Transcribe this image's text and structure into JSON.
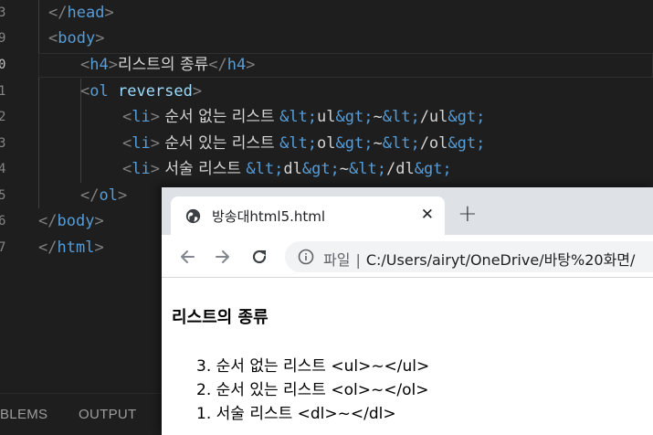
{
  "editor": {
    "line_numbers": [
      "3",
      "9",
      "0",
      "1",
      "2",
      "3",
      "4",
      "5",
      "6",
      "7"
    ],
    "lines": [
      {
        "id": "head-close",
        "tokens": [
          {
            "c": "tb",
            "t": "</"
          },
          {
            "c": "tn",
            "t": "head"
          },
          {
            "c": "tb",
            "t": ">"
          }
        ]
      },
      {
        "id": "body-open",
        "tokens": [
          {
            "c": "tb",
            "t": "<"
          },
          {
            "c": "tn",
            "t": "body"
          },
          {
            "c": "tb",
            "t": ">"
          }
        ]
      },
      {
        "id": "h4",
        "tokens": [
          {
            "c": "tb",
            "t": "<"
          },
          {
            "c": "tn",
            "t": "h4"
          },
          {
            "c": "tb",
            "t": ">"
          },
          {
            "c": "tx",
            "t": "리스트의 종류"
          },
          {
            "c": "tb",
            "t": "</"
          },
          {
            "c": "tn",
            "t": "h4"
          },
          {
            "c": "tb",
            "t": ">"
          }
        ]
      },
      {
        "id": "ol-open",
        "tokens": [
          {
            "c": "tb",
            "t": "<"
          },
          {
            "c": "tn",
            "t": "ol"
          },
          {
            "c": "et",
            "t": " "
          },
          {
            "c": "at",
            "t": "reversed"
          },
          {
            "c": "tb",
            "t": ">"
          }
        ]
      },
      {
        "id": "li-1",
        "tokens": [
          {
            "c": "tb",
            "t": "<"
          },
          {
            "c": "tn",
            "t": "li"
          },
          {
            "c": "tb",
            "t": ">"
          },
          {
            "c": "tx",
            "t": " 순서 없는 리스트 "
          },
          {
            "c": "en",
            "t": "&lt;"
          },
          {
            "c": "et",
            "t": "ul"
          },
          {
            "c": "en",
            "t": "&gt;"
          },
          {
            "c": "et",
            "t": "~"
          },
          {
            "c": "en",
            "t": "&lt;"
          },
          {
            "c": "et",
            "t": "/ul"
          },
          {
            "c": "en",
            "t": "&gt;"
          }
        ]
      },
      {
        "id": "li-2",
        "tokens": [
          {
            "c": "tb",
            "t": "<"
          },
          {
            "c": "tn",
            "t": "li"
          },
          {
            "c": "tb",
            "t": ">"
          },
          {
            "c": "tx",
            "t": " 순서 있는 리스트 "
          },
          {
            "c": "en",
            "t": "&lt;"
          },
          {
            "c": "et",
            "t": "ol"
          },
          {
            "c": "en",
            "t": "&gt;"
          },
          {
            "c": "et",
            "t": "~"
          },
          {
            "c": "en",
            "t": "&lt;"
          },
          {
            "c": "et",
            "t": "/ol"
          },
          {
            "c": "en",
            "t": "&gt;"
          }
        ]
      },
      {
        "id": "li-3",
        "tokens": [
          {
            "c": "tb",
            "t": "<"
          },
          {
            "c": "tn",
            "t": "li"
          },
          {
            "c": "tb",
            "t": ">"
          },
          {
            "c": "tx",
            "t": " 서술 리스트 "
          },
          {
            "c": "en",
            "t": "&lt;"
          },
          {
            "c": "et",
            "t": "dl"
          },
          {
            "c": "en",
            "t": "&gt;"
          },
          {
            "c": "et",
            "t": "~"
          },
          {
            "c": "en",
            "t": "&lt;"
          },
          {
            "c": "et",
            "t": "/dl"
          },
          {
            "c": "en",
            "t": "&gt;"
          }
        ]
      },
      {
        "id": "ol-close",
        "tokens": [
          {
            "c": "tb",
            "t": "</"
          },
          {
            "c": "tn",
            "t": "ol"
          },
          {
            "c": "tb",
            "t": ">"
          }
        ]
      },
      {
        "id": "body-close",
        "tokens": [
          {
            "c": "tb",
            "t": "</"
          },
          {
            "c": "tn",
            "t": "body"
          },
          {
            "c": "tb",
            "t": ">"
          }
        ]
      },
      {
        "id": "html-close",
        "tokens": [
          {
            "c": "tb",
            "t": "</"
          },
          {
            "c": "tn",
            "t": "html"
          },
          {
            "c": "tb",
            "t": ">"
          }
        ]
      }
    ]
  },
  "panel": {
    "problems_label": "BLEMS",
    "output_label": "OUTPUT"
  },
  "browser": {
    "tab": {
      "favicon": "globe-icon",
      "title": "방송대html5.html",
      "close_glyph": "✕"
    },
    "new_tab_glyph": "+",
    "toolbar": {
      "back_icon": "arrow-left-icon",
      "forward_icon": "arrow-right-icon",
      "reload_icon": "reload-icon",
      "info_icon": "info-icon",
      "file_label": "파일",
      "separator": "|",
      "url": "C:/Users/airyt/OneDrive/바탕%20화면/"
    },
    "page": {
      "heading": "리스트의 종류",
      "items": [
        {
          "number": "3.",
          "text": "순서 없는 리스트 <ul>~</ul>"
        },
        {
          "number": "2.",
          "text": "순서 있는 리스트 <ol>~</ol>"
        },
        {
          "number": "1.",
          "text": "서술 리스트 <dl>~</dl>"
        }
      ]
    }
  },
  "colors": {
    "editor_bg": "#1e1e1e",
    "tag_name": "#569cd6",
    "attribute": "#9cdcfe",
    "bracket": "#808080",
    "text": "#d4d4d4",
    "tabstrip": "#dee1e6",
    "omnibox": "#f1f3f4"
  }
}
